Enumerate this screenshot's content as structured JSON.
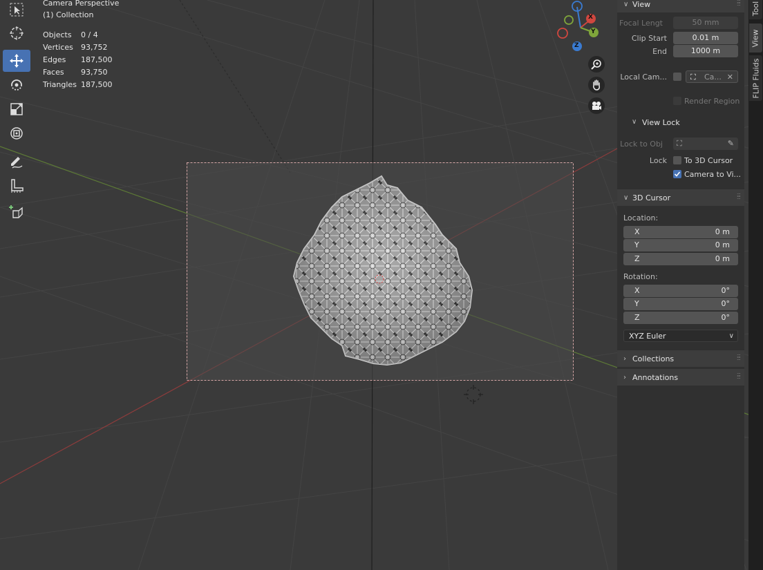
{
  "viewport": {
    "title": "Camera Perspective",
    "collection": "(1) Collection"
  },
  "stats": [
    {
      "label": "Objects",
      "value": "0 / 4"
    },
    {
      "label": "Vertices",
      "value": "93,752"
    },
    {
      "label": "Edges",
      "value": "187,500"
    },
    {
      "label": "Faces",
      "value": "93,750"
    },
    {
      "label": "Triangles",
      "value": "187,500"
    }
  ],
  "gizmo": {
    "x": "X",
    "y": "Y",
    "z": "Z"
  },
  "panel": {
    "view": {
      "header": "View",
      "focal_label": "Focal Lengt",
      "focal_value": "50 mm",
      "clip_start_label": "Clip Start",
      "clip_start_value": "0.01 m",
      "end_label": "End",
      "end_value": "1000 m",
      "local_camera_label": "Local Cam...",
      "local_camera_value": "Ca...",
      "render_region_label": "Render Region"
    },
    "view_lock": {
      "header": "View Lock",
      "lock_to_obj_label": "Lock to Obj",
      "lock_label": "Lock",
      "to_3d_cursor_label": "To 3D Cursor",
      "camera_to_view_label": "Camera to Vi..."
    },
    "cursor": {
      "header": "3D Cursor",
      "location_label": "Location:",
      "loc_x_label": "X",
      "loc_x_value": "0 m",
      "loc_y_label": "Y",
      "loc_y_value": "0 m",
      "loc_z_label": "Z",
      "loc_z_value": "0 m",
      "rotation_label": "Rotation:",
      "rot_x_label": "X",
      "rot_x_value": "0°",
      "rot_y_label": "Y",
      "rot_y_value": "0°",
      "rot_z_label": "Z",
      "rot_z_value": "0°",
      "rotation_mode": "XYZ Euler"
    },
    "collections": {
      "header": "Collections"
    },
    "annotations": {
      "header": "Annotations"
    }
  },
  "tabs": [
    {
      "label": "Tool"
    },
    {
      "label": "View"
    },
    {
      "label": "FLIP Fluids"
    }
  ],
  "colors": {
    "accent": "#4772b3",
    "axis_x": "#d0473f",
    "axis_y": "#7fa53b",
    "axis_z": "#3a7bd1"
  }
}
